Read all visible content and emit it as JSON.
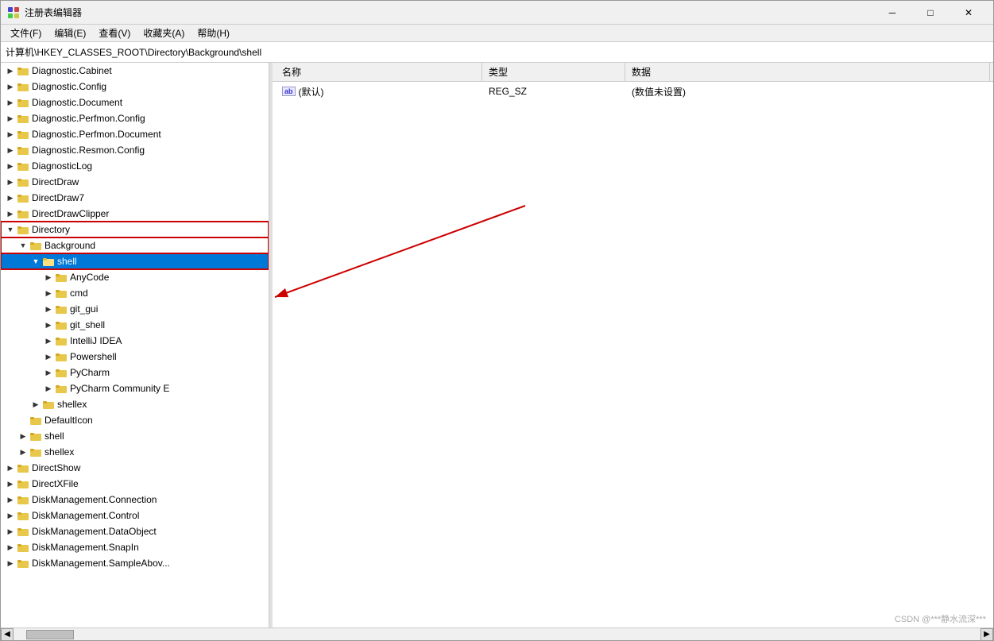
{
  "window": {
    "title": "注册表编辑器",
    "minimize": "─",
    "maximize": "□",
    "close": "✕"
  },
  "menubar": {
    "items": [
      "文件(F)",
      "编辑(E)",
      "查看(V)",
      "收藏夹(A)",
      "帮助(H)"
    ]
  },
  "addressbar": {
    "path": "计算机\\HKEY_CLASSES_ROOT\\Directory\\Background\\shell"
  },
  "tree": {
    "items": [
      {
        "indent": 0,
        "expander": "▶",
        "label": "Diagnostic.Cabinet",
        "level": 0
      },
      {
        "indent": 0,
        "expander": "▶",
        "label": "Diagnostic.Config",
        "level": 0
      },
      {
        "indent": 0,
        "expander": "▶",
        "label": "Diagnostic.Document",
        "level": 0
      },
      {
        "indent": 0,
        "expander": "▶",
        "label": "Diagnostic.Perfmon.Config",
        "level": 0
      },
      {
        "indent": 0,
        "expander": "▶",
        "label": "Diagnostic.Perfmon.Document",
        "level": 0
      },
      {
        "indent": 0,
        "expander": "▶",
        "label": "Diagnostic.Resmon.Config",
        "level": 0
      },
      {
        "indent": 0,
        "expander": "▶",
        "label": "DiagnosticLog",
        "level": 0
      },
      {
        "indent": 0,
        "expander": "▶",
        "label": "DirectDraw",
        "level": 0
      },
      {
        "indent": 0,
        "expander": "▶",
        "label": "DirectDraw7",
        "level": 0
      },
      {
        "indent": 0,
        "expander": "▶",
        "label": "DirectDrawClipper",
        "level": 0
      },
      {
        "indent": 0,
        "expander": "▼",
        "label": "Directory",
        "level": 0,
        "highlighted_box": true
      },
      {
        "indent": 1,
        "expander": "▼",
        "label": "Background",
        "level": 1,
        "highlighted_box": true
      },
      {
        "indent": 2,
        "expander": "▼",
        "label": "shell",
        "level": 2,
        "selected": true,
        "highlighted_box": true
      },
      {
        "indent": 3,
        "expander": "▶",
        "label": "AnyCode",
        "level": 3
      },
      {
        "indent": 3,
        "expander": "▶",
        "label": "cmd",
        "level": 3
      },
      {
        "indent": 3,
        "expander": "▶",
        "label": "git_gui",
        "level": 3
      },
      {
        "indent": 3,
        "expander": "▶",
        "label": "git_shell",
        "level": 3
      },
      {
        "indent": 3,
        "expander": "▶",
        "label": "IntelliJ IDEA",
        "level": 3
      },
      {
        "indent": 3,
        "expander": "▶",
        "label": "Powershell",
        "level": 3
      },
      {
        "indent": 3,
        "expander": "▶",
        "label": "PyCharm",
        "level": 3
      },
      {
        "indent": 3,
        "expander": "▶",
        "label": "PyCharm Community E",
        "level": 3
      },
      {
        "indent": 2,
        "expander": "▶",
        "label": "shellex",
        "level": 2
      },
      {
        "indent": 1,
        "expander": " ",
        "label": "DefaultIcon",
        "level": 1
      },
      {
        "indent": 1,
        "expander": "▶",
        "label": "shell",
        "level": 1
      },
      {
        "indent": 1,
        "expander": "▶",
        "label": "shellex",
        "level": 1
      },
      {
        "indent": 0,
        "expander": "▶",
        "label": "DirectShow",
        "level": 0
      },
      {
        "indent": 0,
        "expander": "▶",
        "label": "DirectXFile",
        "level": 0
      },
      {
        "indent": 0,
        "expander": "▶",
        "label": "DiskManagement.Connection",
        "level": 0
      },
      {
        "indent": 0,
        "expander": "▶",
        "label": "DiskManagement.Control",
        "level": 0
      },
      {
        "indent": 0,
        "expander": "▶",
        "label": "DiskManagement.DataObject",
        "level": 0
      },
      {
        "indent": 0,
        "expander": "▶",
        "label": "DiskManagement.SnapIn",
        "level": 0
      },
      {
        "indent": 0,
        "expander": "▶",
        "label": "DiskManagement.SampleAbov...",
        "level": 0
      }
    ]
  },
  "columns": {
    "name": "名称",
    "type": "类型",
    "data": "数据"
  },
  "registry_values": [
    {
      "name": "(默认)",
      "name_prefix": "ab",
      "type": "REG_SZ",
      "data": "(数值未设置)"
    }
  ],
  "watermark": "CSDN @***静水流深***"
}
